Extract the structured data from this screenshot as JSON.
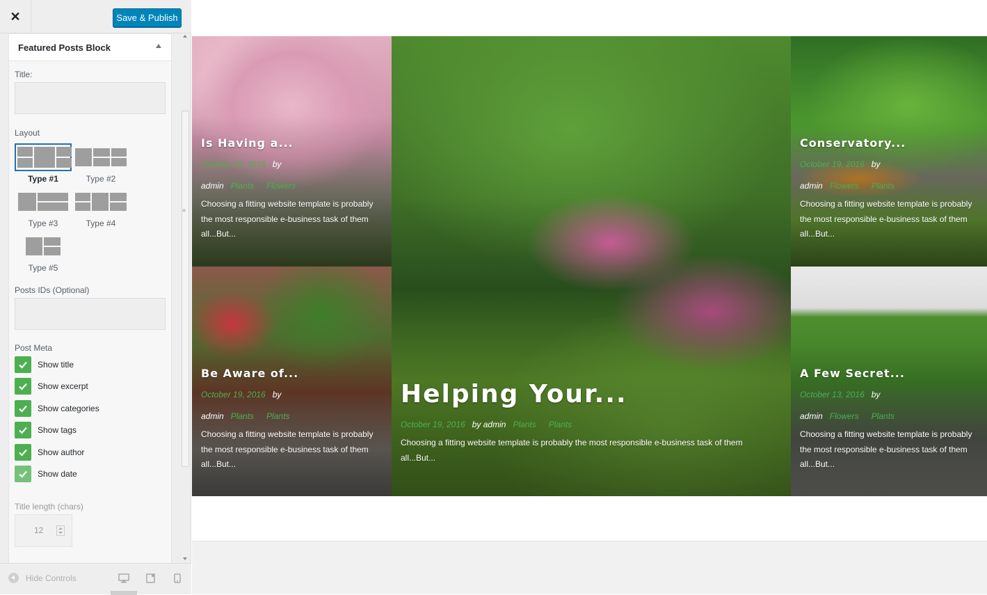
{
  "topbar": {
    "close_icon": "close-icon",
    "close_glyph": "✕",
    "publish_label": "Save & Publish"
  },
  "widget": {
    "title": "Featured Posts Block",
    "title_label": "Title:",
    "title_value": "",
    "layout_label": "Layout",
    "layouts": [
      {
        "label": "Type #1",
        "selected": true
      },
      {
        "label": "Type #2",
        "selected": false
      },
      {
        "label": "Type #3",
        "selected": false
      },
      {
        "label": "Type #4",
        "selected": false
      },
      {
        "label": "Type #5",
        "selected": false
      }
    ],
    "posts_ids_label": "Posts IDs (Optional)",
    "posts_ids_value": "",
    "post_meta_label": "Post Meta",
    "checks": [
      {
        "label": "Show title",
        "checked": true
      },
      {
        "label": "Show excerpt",
        "checked": true
      },
      {
        "label": "Show categories",
        "checked": true
      },
      {
        "label": "Show tags",
        "checked": true
      },
      {
        "label": "Show author",
        "checked": true
      },
      {
        "label": "Show date",
        "checked": true
      }
    ],
    "title_length_label": "Title length (chars)",
    "title_length_value": "12"
  },
  "footer": {
    "hide_controls": "Hide Controls",
    "scroll_grip": "≡"
  },
  "colors": {
    "accent": "#0085ba",
    "check": "#4caf50",
    "meta": "#4caf50"
  },
  "posts": [
    {
      "title": "Is Having a...",
      "date": "October 19, 2016",
      "author": "by admin",
      "categories": [
        "Plants",
        "Flowers"
      ],
      "excerpt": "Choosing a fitting website template is probably the most responsible e-business task of them all...But..."
    },
    {
      "title": "Helping Your...",
      "date": "October 19, 2016",
      "author": "by admin",
      "categories": [
        "Plants",
        "Plants"
      ],
      "excerpt": "Choosing a fitting website template is probably the most responsible e-business task of them all...But..."
    },
    {
      "title": "Conservatory...",
      "date": "October 19, 2016",
      "author": "by admin",
      "categories": [
        "Flowers",
        "Plants"
      ],
      "excerpt": "Choosing a fitting website template is probably the most responsible e-business task of them all...But..."
    },
    {
      "title": "Be Aware of...",
      "date": "October 19, 2016",
      "author": "by admin",
      "categories": [
        "Plants",
        "Plants"
      ],
      "excerpt": "Choosing a fitting website template is probably the most responsible e-business task of them all...But..."
    },
    {
      "title": "A Few Secret...",
      "date": "October 13, 2016",
      "author": "by admin",
      "categories": [
        "Flowers",
        "Plants"
      ],
      "excerpt": "Choosing a fitting website template is probably the most responsible e-business task of them all...But..."
    }
  ]
}
